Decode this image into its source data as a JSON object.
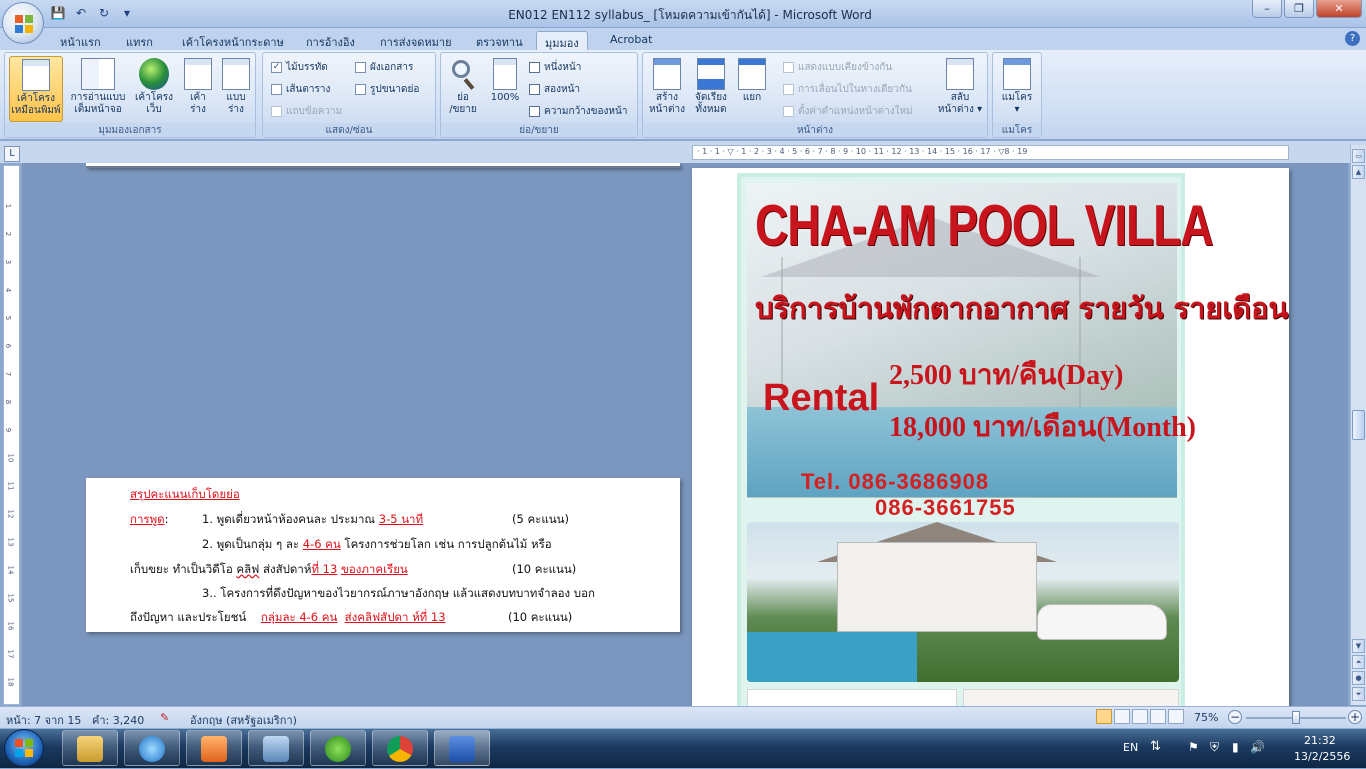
{
  "window": {
    "title": "EN012 EN112 syllabus_ [โหมดความเข้ากันได้] - Microsoft Word",
    "minimize": "–",
    "restore": "❐",
    "close": "✕",
    "help": "?"
  },
  "qat": {
    "save": "💾",
    "undo": "↶",
    "redo": "↻",
    "customize": "▾"
  },
  "tabs": [
    "หน้าแรก",
    "แทรก",
    "เค้าโครงหน้ากระดาษ",
    "การอ้างอิง",
    "การส่งจดหมาย",
    "ตรวจทาน",
    "มุมมอง",
    "Acrobat"
  ],
  "active_tab": "มุมมอง",
  "ribbon": {
    "doc_views": {
      "label": "มุมมองเอกสาร",
      "buttons": [
        {
          "l1": "เค้าโครง",
          "l2": "เหมือนพิมพ์"
        },
        {
          "l1": "การอ่านแบบ",
          "l2": "เต็มหน้าจอ"
        },
        {
          "l1": "เค้าโครง",
          "l2": "เว็บ"
        },
        {
          "l1": "เค้า",
          "l2": "ร่าง"
        },
        {
          "l1": "แบบ",
          "l2": "ร่าง"
        }
      ]
    },
    "show_hide": {
      "label": "แสดง/ซ่อน",
      "items": [
        {
          "text": "ไม้บรรทัด",
          "checked": true
        },
        {
          "text": "ผังเอกสาร",
          "checked": false
        },
        {
          "text": "เส้นตาราง",
          "checked": false
        },
        {
          "text": "รูปขนาดย่อ",
          "checked": false
        },
        {
          "text": "แถบข้อความ",
          "checked": false,
          "disabled": true
        }
      ]
    },
    "zoom": {
      "label": "ย่อ/ขยาย",
      "zoom_l1": "ย่อ",
      "zoom_l2": "/ขยาย",
      "hundred": "100%",
      "one_page": "หนึ่งหน้า",
      "two_pages": "สองหน้า",
      "page_width": "ความกว้างของหน้า"
    },
    "window": {
      "label": "หน้าต่าง",
      "new_l1": "สร้าง",
      "new_l2": "หน้าต่าง",
      "arrange_l1": "จัดเรียง",
      "arrange_l2": "ทั้งหมด",
      "split": "แยก",
      "side_by_side": "แสดงแบบเคียงข้างกัน",
      "sync_scroll": "การเลื่อนไปในทางเดียวกัน",
      "reset_pos": "ตั้งค่าตำแหน่งหน้าต่างใหม่",
      "switch_l1": "สลับ",
      "switch_l2": "หน้าต่าง ▾"
    },
    "macros": {
      "label": "แมโคร",
      "btn": "แมโคร",
      "arrow": "▾"
    }
  },
  "ruler": {
    "corner": "L",
    "h_ticks": "· 1 · 1 · ▽ · 1 · 2 · 3 · 4 · 5 · 6 · 7 · 8 · 9 · 10 · 11 · 12 · 13 · 14 · 15 · 16 · 17 · ▽8 · 19"
  },
  "left_page": {
    "heading": "สรุปคะแนนเก็บโดยย่อ",
    "l1_label": "การพูด",
    "l1_colon": ":",
    "l1_num": "1.",
    "l1_text": "พูดเดี่ยวหน้าห้องคนละ ประมาณ",
    "l1_red": "3-5 นาที",
    "l1_score": "(5 คะแนน)",
    "l2_text": "2. พูดเป็นกลุ่ม ๆ ละ",
    "l2_red": "4-6 คน",
    "l2_text2": "โครงการช่วยโลก เช่น การปลูกต้นไม้ หรือ",
    "l3_text": "เก็บขยะ ทำเป็นวิดีโอ",
    "l3_w": "คลิฟ",
    "l3_text2": "ส่งสัปดาห์",
    "l3_red1": "ที่ 13",
    "l3_red2": "ของภาคเรียน",
    "l3_score": "(10 คะแนน)",
    "l4_text": "3.. โครงการที่ดึงปัญหาของไวยากรณ์ภาษาอังกฤษ แล้วแสดงบทบาทจำลอง บอก",
    "l5_text": "ถึงปัญหา และประโยชน์",
    "l5_red1": "กลุ่มละ 4-6 คน",
    "l5_red2": "ส่งคลิฟสัปดา ห์ที่ 13",
    "l5_score": "(10 คะแนน)"
  },
  "flyer": {
    "title": "CHA-AM POOL VILLA",
    "subtitle": "บริการบ้านพักตากอากาศ รายวัน รายเดือน",
    "rental": "Rental",
    "price_day": "2,500 บาท/คืน(Day)",
    "price_month": "18,000 บาท/เดือน(Month)",
    "tel1": "Tel. 086-3686908",
    "tel2": "086-3661755"
  },
  "status": {
    "page": "หน้า: 7 จาก 15",
    "words": "คำ: 3,240",
    "lang": "อังกฤษ (สหรัฐอเมริกา)",
    "zoom": "75%",
    "zoom_out": "−",
    "zoom_in": "+",
    "zoom_level": 0.5
  },
  "taskbar": {
    "lang": "EN",
    "time": "21:32",
    "date": "13/2/2556"
  },
  "colors": {
    "accent": "#c8141c",
    "ribbon": "#cfdef3",
    "doc_bg": "#7c97bf"
  }
}
